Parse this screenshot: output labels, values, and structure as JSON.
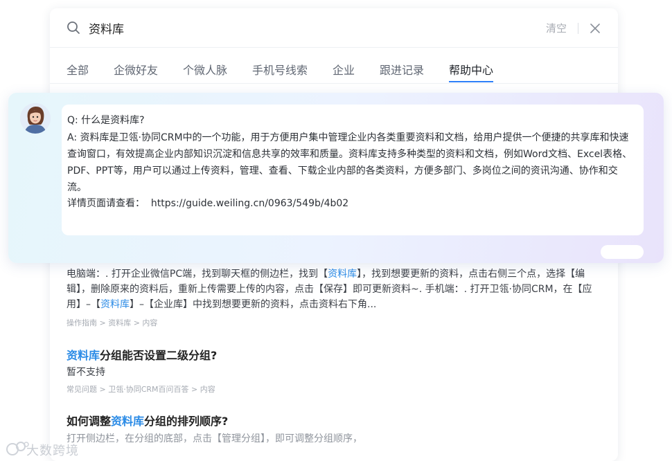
{
  "search": {
    "query": "资料库",
    "clear_label": "清空"
  },
  "tabs": [
    {
      "label": "全部"
    },
    {
      "label": "企微好友"
    },
    {
      "label": "个微人脉"
    },
    {
      "label": "手机号线索"
    },
    {
      "label": "企业"
    },
    {
      "label": "跟进记录"
    },
    {
      "label": "帮助中心",
      "active": true
    }
  ],
  "ai_answer": {
    "question": "Q: 什么是资料库?",
    "answer": "A: 资料库是卫瓴·协同CRM中的一个功能，用于方便用户集中管理企业内各类重要资料和文档，给用户提供一个便捷的共享库和快速查询窗口，有效提高企业内部知识沉淀和信息共享的效率和质量。资料库支持多种类型的资料和文档，例如Word文档、Excel表格、PDF、PPT等，用户可以通过上传资料，管理、查看、下载企业内部的各类资料，方便多部门、多岗位之间的资讯沟通、协作和交流。",
    "detail_label": "详情页面请查看：",
    "detail_url": "https://guide.weiling.cn/0963/549b/4b02"
  },
  "results": [
    {
      "snippet_parts": [
        "电脑端：. 打开企业微信PC端，找到聊天框的侧边栏，找到【",
        "资料库",
        "】，找到想要更新的资料，点击右侧三个点，选择【编辑】，删除原来的资料后，重新上传需要上传的内容，点击【保存】即可更新资料~. 手机端：. 打开卫瓴·协同CRM，在【应用】–【",
        "资料库",
        "】–【企业库】中找到想要更新的资料，点击资料右下角..."
      ],
      "breadcrumb": "操作指南 > 资料库 > 内容"
    },
    {
      "title_highlight": "资料库",
      "title_rest": "分组能否设置二级分组?",
      "snippet": "暂不支持",
      "breadcrumb": "常见问题 > 卫瓴·协同CRM百问百答 > 内容"
    },
    {
      "title_prefix": "如何调整",
      "title_highlight": "资料库",
      "title_rest": "分组的排列顺序?",
      "snippet": "打开侧边栏，在分组的底部，点击【管理分组】，即可调整分组顺序，"
    }
  ],
  "watermark": {
    "text": "大数跨境"
  },
  "colors": {
    "accent": "#2d7ff9",
    "highlight": "#2b8be6"
  }
}
